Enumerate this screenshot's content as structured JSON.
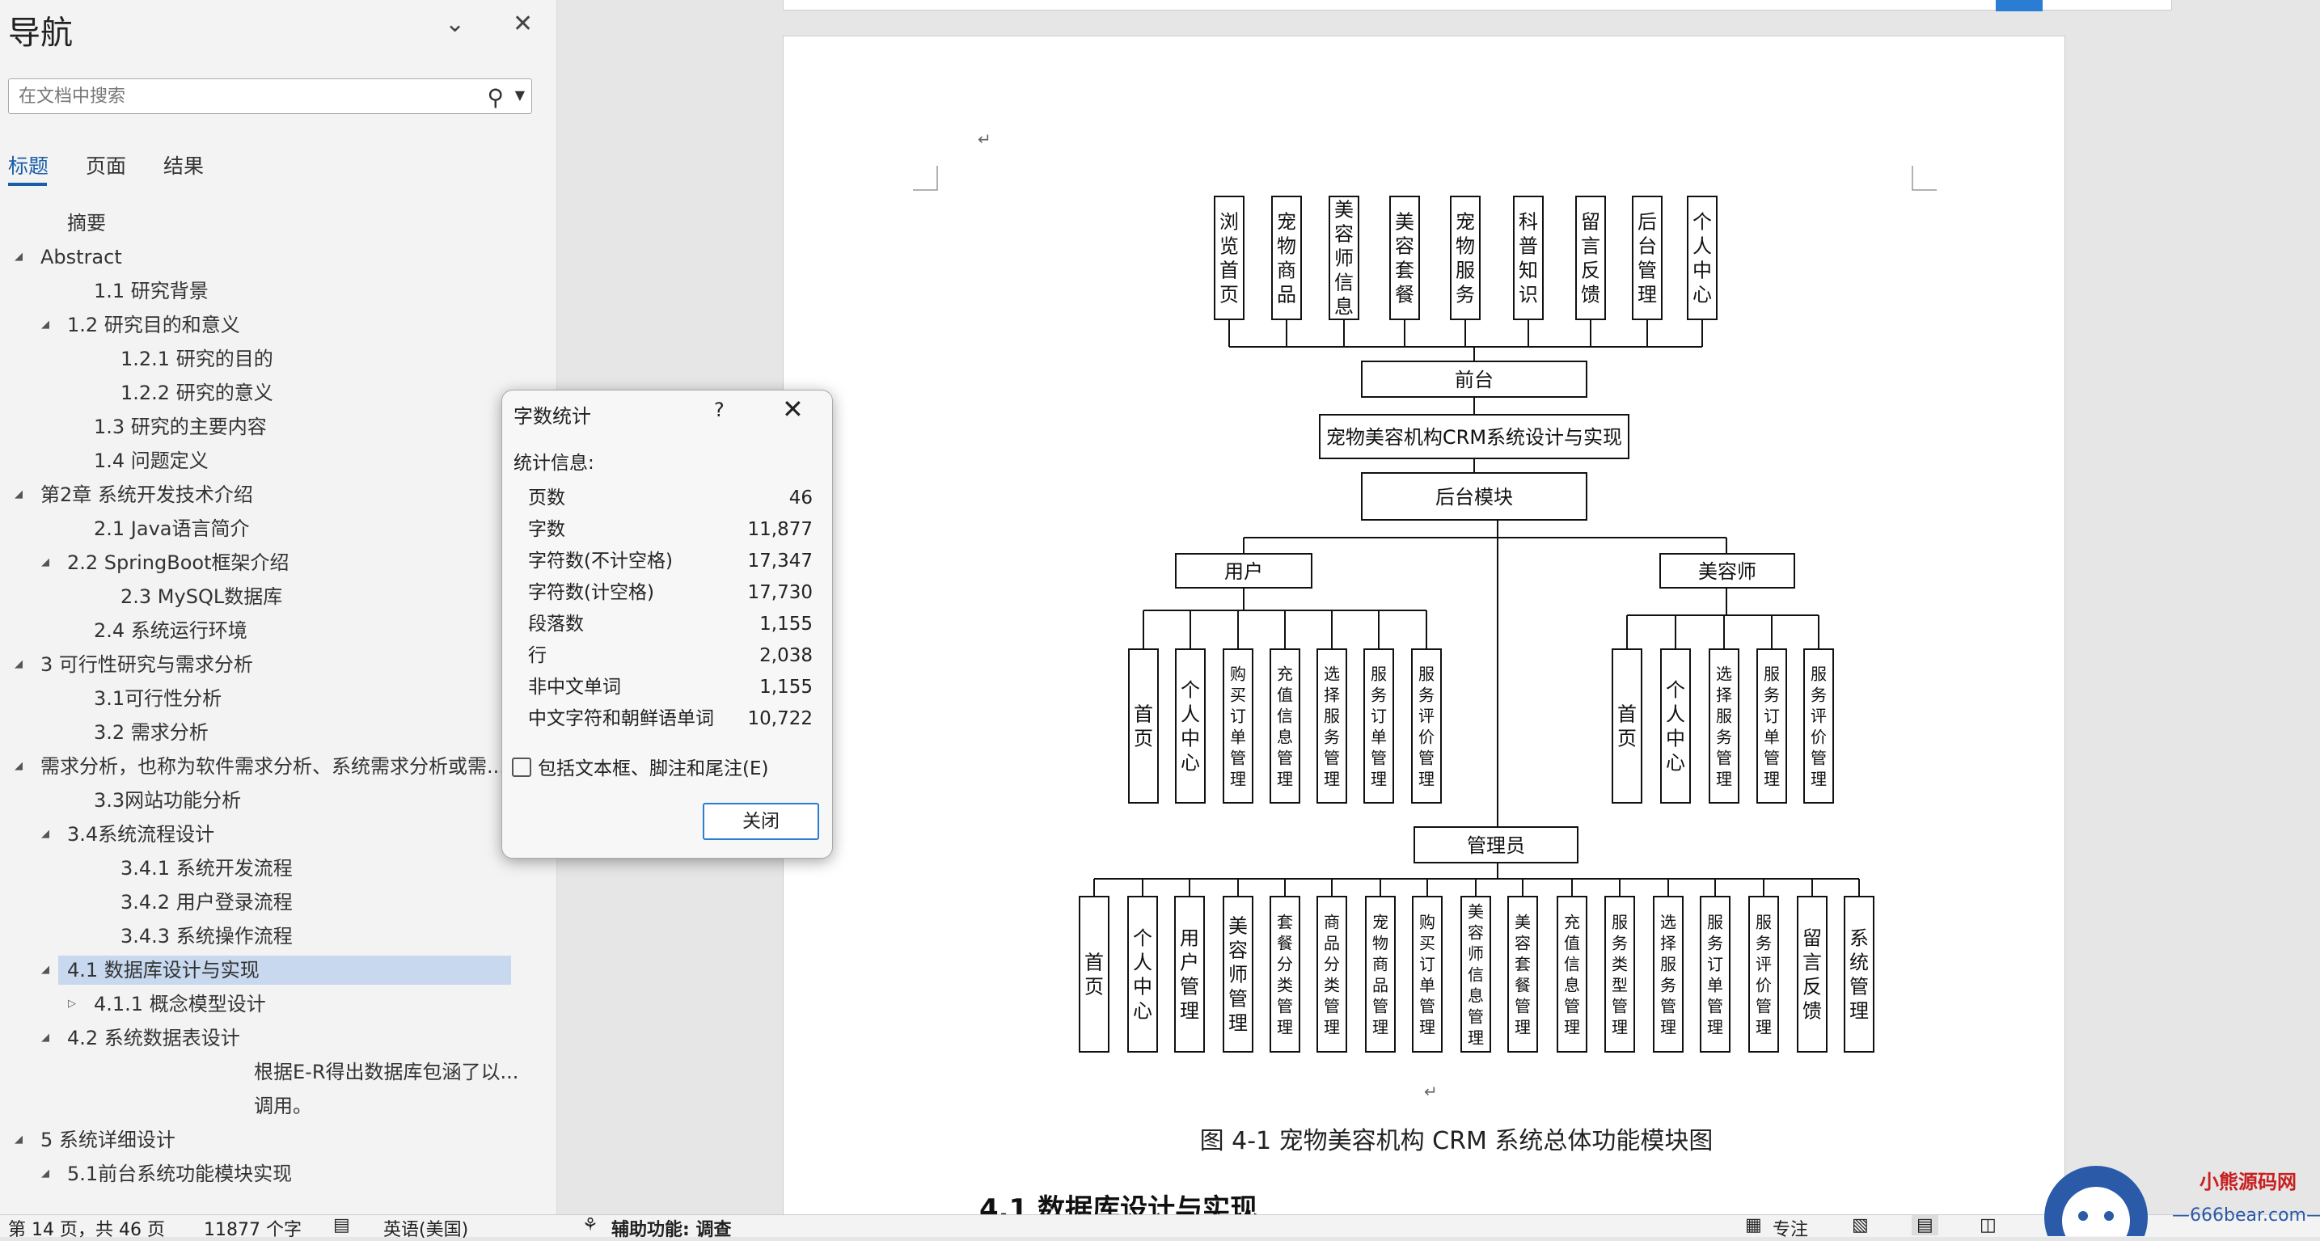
{
  "nav": {
    "title": "导航",
    "search_placeholder": "在文档中搜索",
    "tabs": [
      "标题",
      "页面",
      "结果"
    ],
    "items": [
      {
        "label": "摘要",
        "level": 1,
        "expander": "none"
      },
      {
        "label": "Abstract",
        "level": 0,
        "expander": "expanded"
      },
      {
        "label": "1.1 研究背景",
        "level": 2,
        "expander": "none"
      },
      {
        "label": "1.2 研究目的和意义",
        "level": 1,
        "expander": "expanded"
      },
      {
        "label": "1.2.1 研究的目的",
        "level": 3,
        "expander": "none"
      },
      {
        "label": "1.2.2 研究的意义",
        "level": 3,
        "expander": "none"
      },
      {
        "label": "1.3 研究的主要内容",
        "level": 2,
        "expander": "none"
      },
      {
        "label": "1.4 问题定义",
        "level": 2,
        "expander": "none"
      },
      {
        "label": "第2章 系统开发技术介绍",
        "level": 0,
        "expander": "expanded"
      },
      {
        "label": "2.1 Java语言简介",
        "level": 2,
        "expander": "none"
      },
      {
        "label": "2.2 SpringBoot框架介绍",
        "level": 1,
        "expander": "expanded"
      },
      {
        "label": "2.3 MySQL数据库",
        "level": 3,
        "expander": "none"
      },
      {
        "label": "2.4  系统运行环境",
        "level": 2,
        "expander": "none"
      },
      {
        "label": "3 可行性研究与需求分析",
        "level": 0,
        "expander": "expanded"
      },
      {
        "label": "3.1可行性分析",
        "level": 2,
        "expander": "none"
      },
      {
        "label": "3.2 需求分析",
        "level": 2,
        "expander": "none"
      },
      {
        "label": "需求分析，也称为软件需求分析、系统需求分析或需...",
        "level": 0,
        "expander": "expanded"
      },
      {
        "label": "3.3网站功能分析",
        "level": 2,
        "expander": "none"
      },
      {
        "label": "3.4系统流程设计",
        "level": 1,
        "expander": "expanded"
      },
      {
        "label": "3.4.1 系统开发流程",
        "level": 3,
        "expander": "none"
      },
      {
        "label": "3.4.2 用户登录流程",
        "level": 3,
        "expander": "none"
      },
      {
        "label": "3.4.3 系统操作流程",
        "level": 3,
        "expander": "none"
      },
      {
        "label": "4.1 数据库设计与实现",
        "level": 1,
        "expander": "expanded",
        "selected": true
      },
      {
        "label": "4.1.1 概念模型设计",
        "level": 2,
        "expander": "collapsed"
      },
      {
        "label": "4.2 系统数据表设计",
        "level": 1,
        "expander": "expanded"
      },
      {
        "label": "根据E-R得出数据库包涵了以...",
        "level": 8,
        "expander": "none"
      },
      {
        "label": "调用。",
        "level": 8,
        "expander": "none"
      },
      {
        "label": "5 系统详细设计",
        "level": 0,
        "expander": "expanded"
      },
      {
        "label": "5.1前台系统功能模块实现",
        "level": 1,
        "expander": "expanded"
      }
    ]
  },
  "dialog": {
    "title": "字数统计",
    "help": "?",
    "section": "统计信息:",
    "stats": [
      {
        "label": "页数",
        "value": "46"
      },
      {
        "label": "字数",
        "value": "11,877"
      },
      {
        "label": "字符数(不计空格)",
        "value": "17,347"
      },
      {
        "label": "字符数(计空格)",
        "value": "17,730"
      },
      {
        "label": "段落数",
        "value": "1,155"
      },
      {
        "label": "行",
        "value": "2,038"
      },
      {
        "label": "非中文单词",
        "value": "1,155"
      },
      {
        "label": "中文字符和朝鲜语单词",
        "value": "10,722"
      }
    ],
    "checkbox_label": "包括文本框、脚注和尾注(E)",
    "checkbox_checked": false,
    "close_label": "关闭"
  },
  "diagram": {
    "front_modules": [
      "浏览首页",
      "宠物商品",
      "美容师信息",
      "美容套餐",
      "宠物服务",
      "科普知识",
      "留言反馈",
      "后台管理",
      "个人中心"
    ],
    "front": "前台",
    "system": "宠物美容机构CRM系统设计与实现",
    "backend": "后台模块",
    "user": "用户",
    "user_modules": [
      "首页",
      "个人中心",
      "购买订单管理",
      "充值信息管理",
      "选择服务管理",
      "服务订单管理",
      "服务评价管理"
    ],
    "beautician": "美容师",
    "beautician_modules": [
      "首页",
      "个人中心",
      "选择服务管理",
      "服务订单管理",
      "服务评价管理"
    ],
    "admin": "管理员",
    "admin_modules": [
      "首页",
      "个人中心",
      "用户管理",
      "美容师管理",
      "套餐分类管理",
      "商品分类管理",
      "宠物商品管理",
      "购买订单管理",
      "美容师信息管理",
      "美容套餐管理",
      "充值信息管理",
      "服务类型管理",
      "选择服务管理",
      "服务订单管理",
      "服务评价管理",
      "留言反馈",
      "系统管理"
    ],
    "caption": "图 4-1 宠物美容机构 CRM 系统总体功能模块图",
    "heading_partial": "4.1 数据库设计与实现"
  },
  "status": {
    "page": "第 14 页，共 46 页",
    "words": "11877 个字",
    "language": "英语(美国)",
    "accessibility": "辅助功能: 调查",
    "focus": "专注"
  },
  "logo": {
    "name": "小熊源码网",
    "url_text": "—666bear.com—"
  }
}
